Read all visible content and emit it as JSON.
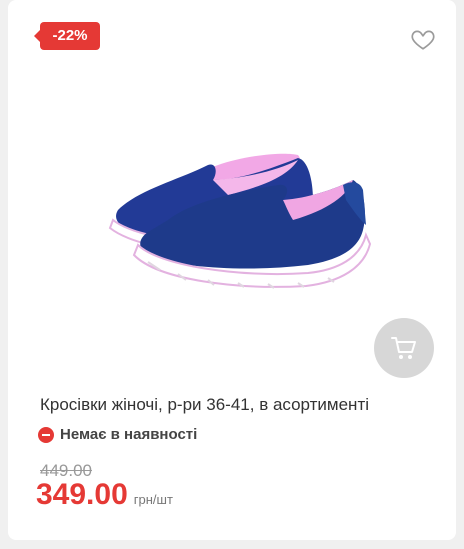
{
  "product": {
    "discount_badge": "-22%",
    "title": "Кросівки жіночі, р-ри 36-41, в асортименті",
    "stock_status": "Немає в наявності",
    "old_price": "449.00",
    "price": "349.00",
    "unit": "грн/шт"
  },
  "icons": {
    "favorite": "heart-outline-icon",
    "cart": "shopping-cart-icon",
    "stock": "minus-circle-icon"
  },
  "colors": {
    "accent": "#e53935",
    "shoe_body": "#1e3a8a",
    "shoe_lining": "#f0a6e3",
    "cart_button_bg": "#d7d7d7"
  }
}
